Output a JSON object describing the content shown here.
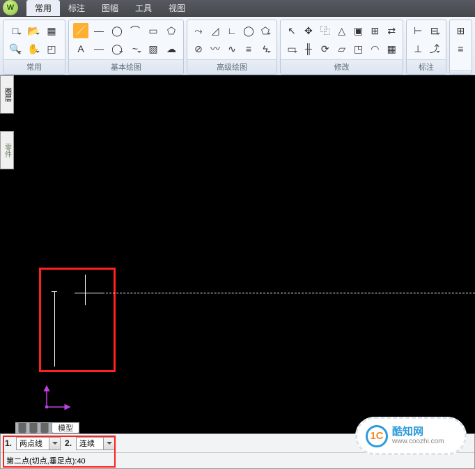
{
  "menu": {
    "tabs": [
      "常用",
      "标注",
      "图幅",
      "工具",
      "视图"
    ],
    "active": 0
  },
  "ribbon": {
    "panels": [
      {
        "label": "常用"
      },
      {
        "label": "基本绘图"
      },
      {
        "label": "高级绘图"
      },
      {
        "label": "修改"
      },
      {
        "label": "标注"
      },
      {
        "label": ""
      }
    ]
  },
  "sidebars": {
    "panel1": "图层",
    "panel2": "零件"
  },
  "layout": {
    "tab": "模型"
  },
  "command": {
    "option1_num": "1.",
    "option1_label": "两点线",
    "option2_num": "2.",
    "option2_label": "连续",
    "prompt": "第二点(切点,垂足点):40"
  },
  "watermark": {
    "logo": "1C",
    "title": "酷知网",
    "url": "www.coozhi.com"
  },
  "icons": {
    "newdoc": "□",
    "open": "📂",
    "save": "💾",
    "layers": "▦",
    "zoomwin": "🔍",
    "pan": "✋",
    "region": "◰",
    "line": "／",
    "xline": "—",
    "circle": "◯",
    "arc": "⌒",
    "rect": "▭",
    "poly": "⬠",
    "curve": "〰",
    "text": "A",
    "hatch": "▨",
    "trim": "✂",
    "cloud": "☁",
    "spline": "~",
    "pline": "⤳",
    "angle": "◿",
    "cham": "∟",
    "ellipse": "◯",
    "penta": "⬠",
    "more": "▾",
    "break": "⊘",
    "wave": "〰",
    "tri": "△",
    "seg": "≡",
    "sp": "∿",
    "curve2": "ϟ",
    "grid3": "⊞",
    "sel": "↖",
    "move": "✥",
    "copy": "⿻",
    "mirror": "△",
    "block": "▣",
    "gridset": "⊞",
    "swap": "⇄",
    "stretch": "▭",
    "breakat": "╫",
    "rot": "⟳",
    "off": "▱",
    "scale": "◳",
    "fillet": "◠",
    "arr": "▦",
    "dim": "⊢",
    "dimset": "⊟",
    "tol": "⊥",
    "align": "⊩",
    "arrow": "↗",
    "lead": "⤴",
    "menu": "≡"
  }
}
